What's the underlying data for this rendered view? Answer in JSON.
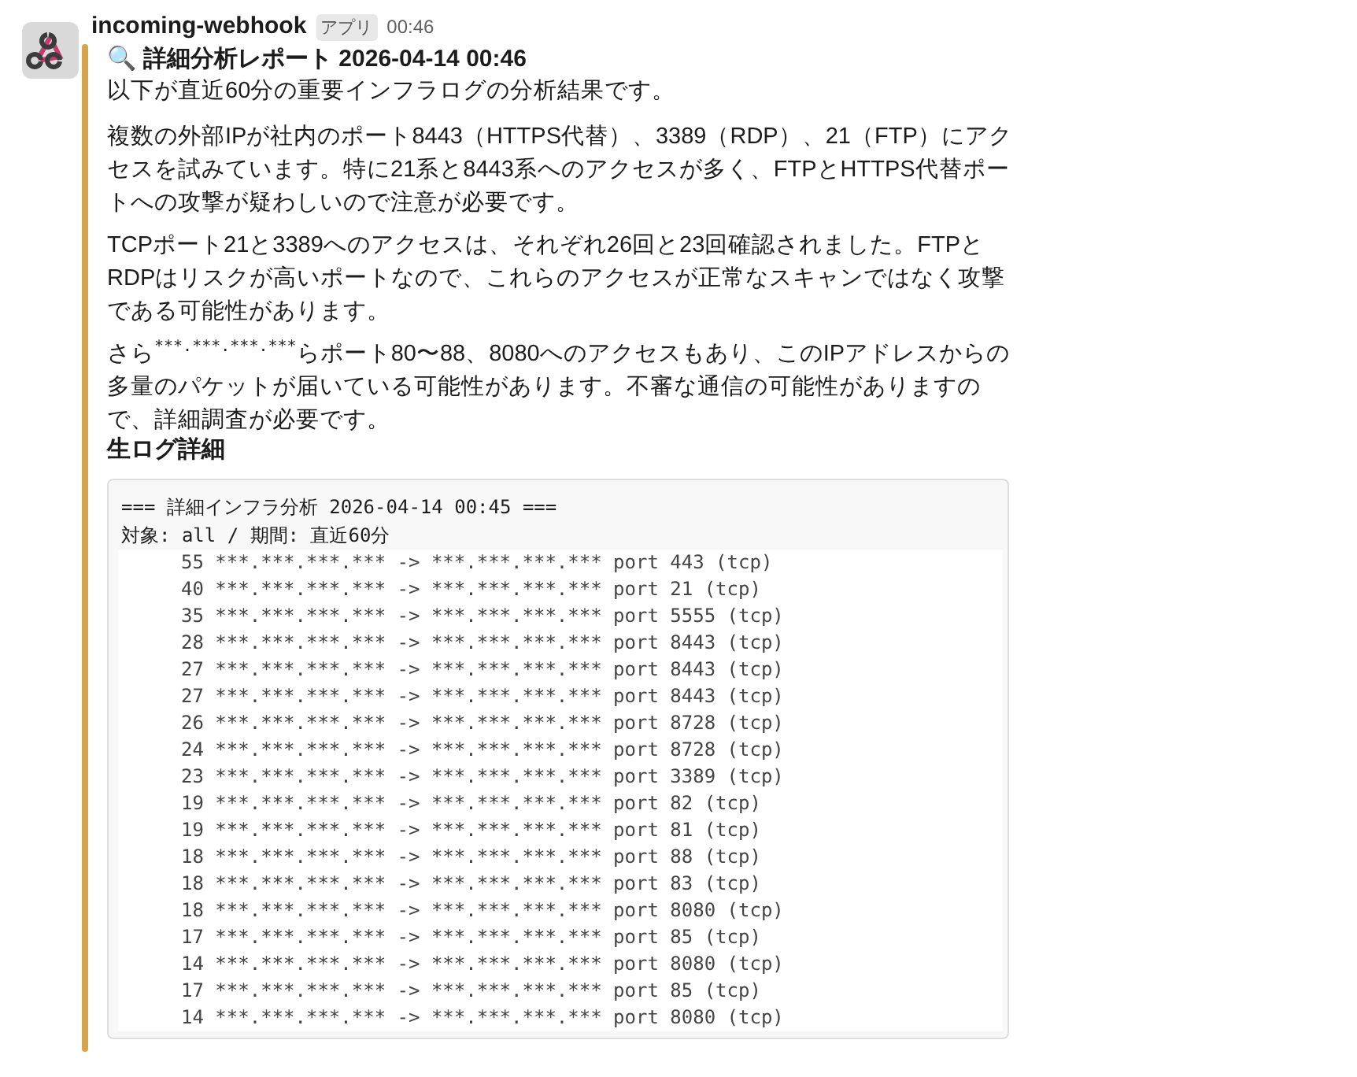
{
  "message": {
    "sender": "incoming-webhook",
    "badge": "アプリ",
    "time": "00:46"
  },
  "attachment": {
    "title_icon": "🔍",
    "title": "詳細分析レポート 2026-04-14 00:46",
    "paragraphs": [
      "以下が直近60分の重要インフラログの分析結果です。",
      "複数の外部IPが社内のポート8443（HTTPS代替）、3389（RDP）、21（FTP）にアクセスを試みています。特に21系と8443系へのアクセスが多く、FTPとHTTPS代替ポートへの攻撃が疑わしいので注意が必要です。",
      "TCPポート21と3389へのアクセスは、それぞれ26回と23回確認されました。FTPとRDPはリスクが高いポートなので、これらのアクセスが正常なスキャンではなく攻撃である可能性があります。",
      {
        "before": "さら",
        "masked": "***.***.***.***",
        "after": "らポート80〜88、8080へのアクセスもあり、このIPアドレスからの多量のパケットが届いている可能性があります。不審な通信の可能性がありますので、詳細調査が必要です。"
      }
    ],
    "section_title": "生ログ詳細",
    "code_header": [
      "=== 詳細インフラ分析 2026-04-14 00:45 ===",
      "対象: all / 期間: 直近60分"
    ],
    "log_rows": [
      "55 ***.***.***.*** -> ***.***.***.*** port 443 (tcp)",
      "40 ***.***.***.*** -> ***.***.***.*** port 21 (tcp)",
      "35 ***.***.***.*** -> ***.***.***.*** port 5555 (tcp)",
      "28 ***.***.***.*** -> ***.***.***.*** port 8443 (tcp)",
      "27 ***.***.***.*** -> ***.***.***.*** port 8443 (tcp)",
      "27 ***.***.***.*** -> ***.***.***.*** port 8443 (tcp)",
      "26 ***.***.***.*** -> ***.***.***.*** port 8728 (tcp)",
      "24 ***.***.***.*** -> ***.***.***.*** port 8728 (tcp)",
      "23 ***.***.***.*** -> ***.***.***.*** port 3389 (tcp)",
      "19 ***.***.***.*** -> ***.***.***.*** port 82 (tcp)",
      "19 ***.***.***.*** -> ***.***.***.*** port 81 (tcp)",
      "18 ***.***.***.*** -> ***.***.***.*** port 88 (tcp)",
      "18 ***.***.***.*** -> ***.***.***.*** port 83 (tcp)",
      "18 ***.***.***.*** -> ***.***.***.*** port 8080 (tcp)",
      "17 ***.***.***.*** -> ***.***.***.*** port 85 (tcp)",
      "14 ***.***.***.*** -> ***.***.***.*** port 8080 (tcp)",
      "17 ***.***.***.*** -> ***.***.***.*** port 85 (tcp)",
      "14 ***.***.***.*** -> ***.***.***.*** port 8080 (tcp)"
    ]
  }
}
